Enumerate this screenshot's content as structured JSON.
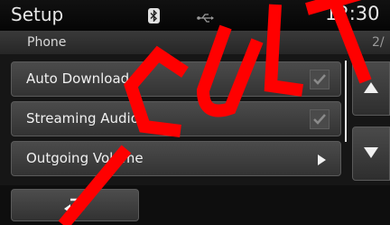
{
  "header": {
    "title": "Setup",
    "clock": "12:30",
    "icons": [
      "bluetooth-icon",
      "usb-icon"
    ]
  },
  "subheader": {
    "title": "Phone",
    "page_indicator": "2/"
  },
  "list": {
    "items": [
      {
        "label": "Auto Download",
        "control": "checkbox",
        "checked": true
      },
      {
        "label": "Streaming Audio",
        "control": "checkbox",
        "checked": true
      },
      {
        "label": "Outgoing Volume",
        "control": "submenu-arrow"
      }
    ]
  },
  "buttons": {
    "back_icon": "return-arrow-icon",
    "scroll_up_icon": "triangle-up-icon",
    "scroll_down_icon": "triangle-down-icon"
  },
  "colors": {
    "background": "#1a1a1a",
    "item": "#404040",
    "text": "#f0f0f0",
    "watermark": "#ff0000"
  }
}
